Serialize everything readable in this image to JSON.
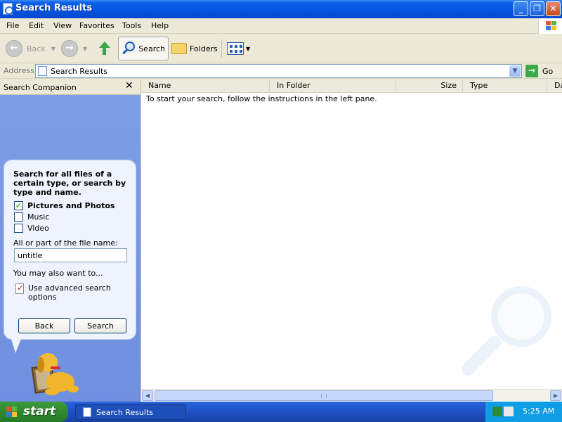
{
  "window": {
    "title": "Search Results"
  },
  "menu": [
    "File",
    "Edit",
    "View",
    "Favorites",
    "Tools",
    "Help"
  ],
  "toolbar": {
    "back": "Back",
    "search": "Search",
    "folders": "Folders"
  },
  "address": {
    "label": "Address",
    "value": "Search Results",
    "go": "Go"
  },
  "companion": {
    "header": "Search Companion",
    "prompt": "Search for all files of a certain type, or search by type and name.",
    "options": [
      {
        "label": "Pictures and Photos",
        "checked": true
      },
      {
        "label": "Music",
        "checked": false
      },
      {
        "label": "Video",
        "checked": false
      }
    ],
    "filename_label": "All or part of the file name:",
    "filename_value": "untitle",
    "also": "You may also want to...",
    "advanced": "Use advanced search options",
    "back_button": "Back",
    "search_button": "Search"
  },
  "results": {
    "columns": [
      "Name",
      "In Folder",
      "Size",
      "Type",
      "Da"
    ],
    "instructions": "To start your search, follow the instructions in the left pane."
  },
  "taskbar": {
    "start": "start",
    "task": "Search Results",
    "time": "5:25 AM"
  }
}
